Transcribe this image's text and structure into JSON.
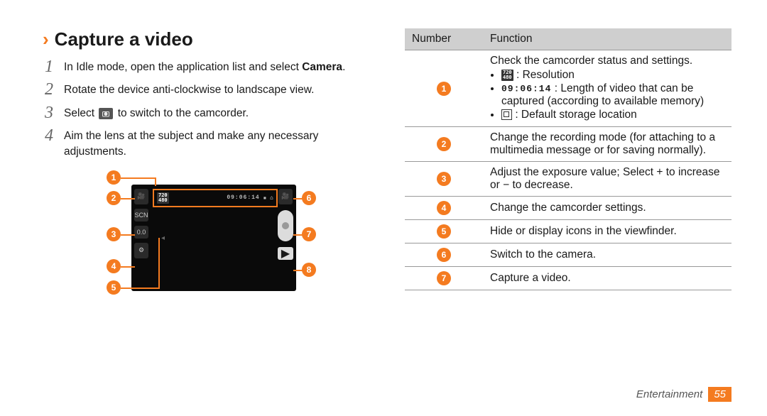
{
  "heading": "Capture a video",
  "steps": [
    {
      "num": "1",
      "pre": "In Idle mode, open the application list and select ",
      "bold": "Camera",
      "post": "."
    },
    {
      "num": "2",
      "text": "Rotate the device anti-clockwise to landscape view."
    },
    {
      "num": "3",
      "pre": "Select ",
      "icon": "camera-mode-icon",
      "post": " to switch to the camcorder."
    },
    {
      "num": "4",
      "text": "Aim the lens at the subject and make any necessary adjustments."
    }
  ],
  "diagram": {
    "resolution_top": "720",
    "resolution_bottom": "480",
    "timecode": "09:06:14",
    "callouts": [
      "1",
      "2",
      "3",
      "4",
      "5",
      "6",
      "7",
      "8"
    ]
  },
  "table": {
    "header_num": "Number",
    "header_func": "Function",
    "rows": [
      {
        "n": "1",
        "intro": "Check the camcorder status and settings.",
        "bullets": [
          {
            "icon": "resolution",
            "text": ": Resolution"
          },
          {
            "icon": "timecode",
            "timecode": "09:06:14",
            "text": ": Length of video that can be captured (according to available memory)"
          },
          {
            "icon": "storage",
            "text": ": Default storage location"
          }
        ]
      },
      {
        "n": "2",
        "text": "Change the recording mode (for attaching to a multimedia message or for saving normally)."
      },
      {
        "n": "3",
        "text": "Adjust the exposure value; Select + to increase or − to decrease."
      },
      {
        "n": "4",
        "text": "Change the camcorder settings."
      },
      {
        "n": "5",
        "text": "Hide or display icons in the viewfinder."
      },
      {
        "n": "6",
        "text": "Switch to the camera."
      },
      {
        "n": "7",
        "text": "Capture a video."
      }
    ]
  },
  "footer": {
    "section": "Entertainment",
    "page": "55"
  }
}
